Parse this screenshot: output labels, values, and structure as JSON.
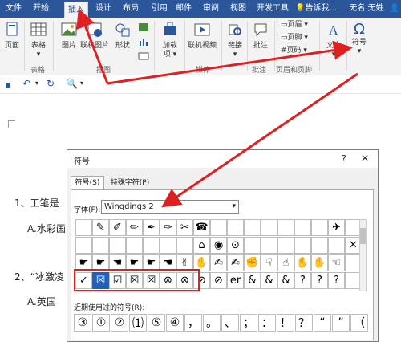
{
  "tabs": [
    "文件",
    "开始",
    "插入",
    "设计",
    "布局",
    "引用",
    "邮件",
    "审阅",
    "视图",
    "开发工具"
  ],
  "tell_me": "告诉我...",
  "user": "无名 无姓",
  "share": "共",
  "ribbon": {
    "page": "页面",
    "table": "表格",
    "table_group": "表格",
    "picture": "图片",
    "online_picture": "联机图片",
    "shapes": "形状",
    "illus_group": "插图",
    "addins_line1": "加载",
    "addins_line2": "项 ▾",
    "online_video": "联机视频",
    "media_group": "媒体",
    "link": "链接",
    "comment": "批注",
    "comment_group": "批注",
    "header": "页眉 ▾",
    "footer": "页脚 ▾",
    "page_number": "页码 ▾",
    "header_footer_group": "页眉和页脚",
    "textbox": "文本",
    "symbol": "符号",
    "omega": "Ω"
  },
  "document": {
    "q1": "1、工笔是",
    "q1a": "A.水彩画",
    "q2": "2、“冰激凌",
    "q2a": "A.英国"
  },
  "dialog": {
    "title": "符号",
    "help": "?",
    "close": "✕",
    "tab_symbols": "符号(S)",
    "tab_special": "特殊字符(P)",
    "font_label": "字体(F):",
    "font_value": "Wingdings 2",
    "recent_label": "近期使用过的符号(R):",
    "grid": [
      [
        "",
        "✎",
        "✐",
        "✏",
        "✒",
        "✑",
        "✂",
        "☎",
        "",
        "",
        "",
        "",
        "",
        "",
        "",
        "✈",
        ""
      ],
      [
        "",
        "",
        "",
        "",
        "",
        "",
        "",
        "⌂",
        "◉",
        "⊙",
        "",
        "",
        "",
        "",
        "",
        "",
        "✕"
      ],
      [
        "☛",
        "☛",
        "☚",
        "☛",
        "☛",
        "☚",
        "✌",
        "✋",
        "✍",
        "✍",
        "✊",
        "☟",
        "☝",
        "✋",
        "✋",
        "☜",
        ""
      ],
      [
        "✓",
        "☒",
        "☑",
        "☒",
        "☒",
        "⊗",
        "⊗",
        "⊘",
        "⊘",
        "er",
        "&",
        "&",
        "&",
        "?",
        "?",
        "?",
        ""
      ]
    ],
    "recent": [
      "③",
      "①",
      "②",
      "⑴",
      "⑤",
      "④",
      "，",
      "。",
      "、",
      "；",
      "：",
      "！",
      "？",
      "“",
      "”",
      "（"
    ]
  }
}
